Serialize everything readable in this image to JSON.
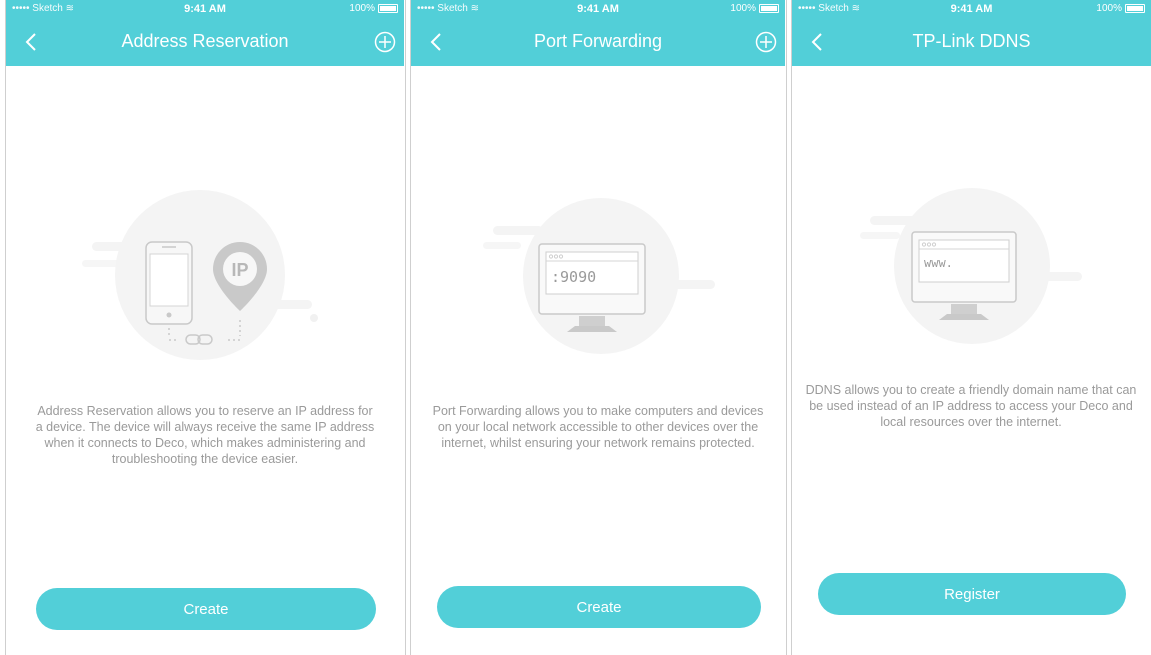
{
  "status_bar": {
    "carrier": "••••• Sketch",
    "time": "9:41 AM",
    "battery": "100%"
  },
  "screens": [
    {
      "title": "Address Reservation",
      "illustration": {
        "badge": "IP"
      },
      "description": "Address Reservation allows you to reserve an IP address for a device. The device will always receive the same IP address when it connects to Deco, which makes administering and troubleshooting the device easier.",
      "button": "Create"
    },
    {
      "title": "Port Forwarding",
      "illustration": {
        "screen_text": ":9090"
      },
      "description": "Port Forwarding allows you to make computers and devices on your local network accessible to other devices over the internet, whilst ensuring your network remains protected.",
      "button": "Create"
    },
    {
      "title": "TP-Link DDNS",
      "illustration": {
        "screen_text": "www."
      },
      "description": "DDNS allows you to create a friendly domain name that can be used instead of an IP address to access your Deco and local resources over the internet.",
      "button": "Register"
    }
  ],
  "icons": {
    "back": "chevron-left-icon",
    "add": "plus-circle-icon",
    "wifi": "wifi-icon",
    "battery": "battery-icon"
  },
  "colors": {
    "accent": "#52cfd8",
    "text_muted": "#9a9a9a",
    "illustration_bg": "#f4f4f4",
    "illustration_line": "#c9c9c9"
  }
}
